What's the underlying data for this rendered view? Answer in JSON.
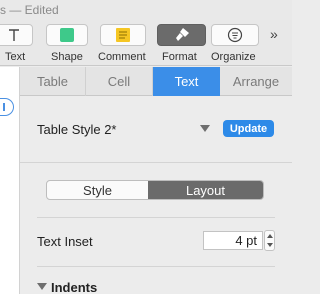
{
  "window": {
    "title": "s — Edited"
  },
  "toolbar": {
    "items": [
      {
        "label": "Text",
        "icon": "text-icon"
      },
      {
        "label": "Shape",
        "icon": "shape-icon"
      },
      {
        "label": "Comment",
        "icon": "comment-icon"
      },
      {
        "label": "Format",
        "icon": "format-brush-icon",
        "active": true
      },
      {
        "label": "Organize",
        "icon": "organize-icon"
      }
    ],
    "overflow": "»"
  },
  "inspector": {
    "tabs": [
      {
        "label": "Table"
      },
      {
        "label": "Cell"
      },
      {
        "label": "Text",
        "active": true
      },
      {
        "label": "Arrange"
      }
    ],
    "style_name": "Table Style 2*",
    "update_label": "Update",
    "segmented": {
      "style": "Style",
      "layout": "Layout",
      "selected": "Layout"
    },
    "text_inset_label": "Text Inset",
    "text_inset_value": "4 pt",
    "indents_label": "Indents"
  },
  "colors": {
    "accent": "#3b8ee8",
    "update": "#2d8ae8",
    "shape_green": "#3ec98a",
    "comment_yellow": "#f5c623",
    "active_dark": "#6b6b6b"
  }
}
